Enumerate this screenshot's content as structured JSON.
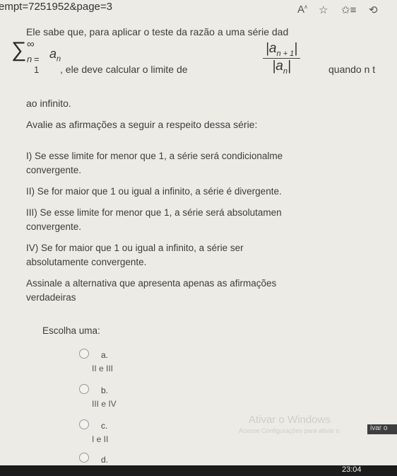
{
  "browser": {
    "url_fragment": "empt=7251952&page=3",
    "icons": [
      "text-size-icon",
      "star-icon",
      "favorites-icon",
      "history-icon"
    ]
  },
  "question": {
    "intro": "Ele sabe que, para aplicar o teste da razão a uma série dad",
    "formula_prefix": ", ele deve calcular o limite de",
    "formula_suffix": "quando n t",
    "line3": "ao infinito.",
    "instruction": "Avalie as afirmações a seguir a respeito dessa série:",
    "items": [
      {
        "line1": "I) Se esse limite for menor que 1, a série será condicionalme",
        "line2": "convergente."
      },
      {
        "line1": "II) Se for maior que 1 ou igual a infinito, a série é divergente.",
        "line2": ""
      },
      {
        "line1": "III) Se esse limite for menor que 1, a série será absolutamen",
        "line2": "convergente."
      },
      {
        "line1": "IV) Se for maior que 1 ou igual a infinito, a série ser",
        "line2": "absolutamente convergente."
      }
    ],
    "prompt_line1": "Assinale a alternativa que apresenta apenas as afirmações",
    "prompt_line2": "verdadeiras",
    "choose": "Escolha uma:"
  },
  "options": [
    {
      "letter": "a.",
      "text": "II e III"
    },
    {
      "letter": "b.",
      "text": "III e IV"
    },
    {
      "letter": "c.",
      "text": "I e II"
    },
    {
      "letter": "d.",
      "text": ""
    }
  ],
  "watermark": {
    "line1": "Ativar o Windows",
    "line2": "Acesse Configurações para ativar o"
  },
  "activation_button": "ivar o",
  "taskbar": {
    "clock": "23:04"
  }
}
